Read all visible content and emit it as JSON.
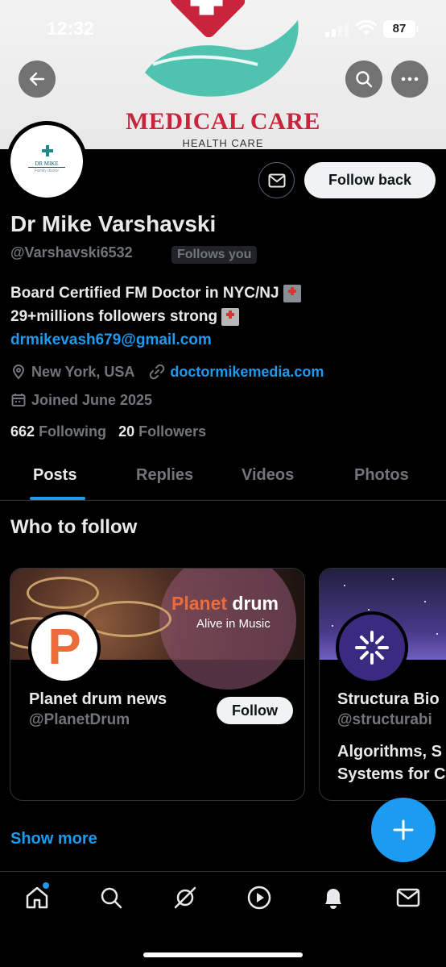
{
  "status_bar": {
    "time": "12:32",
    "battery": "87"
  },
  "banner": {
    "title": "MEDICAL CARE",
    "subtitle": "HEALTH CARE",
    "accent": "#c8243c",
    "hand_color": "#4fc3b0"
  },
  "avatar": {
    "brand": "DR MIKE",
    "brand_sub": "Family doctor"
  },
  "actions": {
    "follow_back_label": "Follow back"
  },
  "profile": {
    "name": "Dr Mike Varshavski",
    "handle": "@Varshavski6532",
    "follows_you": "Follows you",
    "bio_line1": "Board Certified FM Doctor in NYC/NJ",
    "bio_line2": "29+millions followers strong",
    "bio_email": "drmikevash679@gmail.com",
    "location": "New York, USA",
    "website": "doctormikemedia.com",
    "joined": "Joined June 2025",
    "following_count": "662",
    "following_label": "Following",
    "followers_count": "20",
    "followers_label": "Followers"
  },
  "tabs": [
    {
      "label": "Posts",
      "active": true
    },
    {
      "label": "Replies"
    },
    {
      "label": "Videos"
    },
    {
      "label": "Photos"
    }
  ],
  "who_to_follow": {
    "title": "Who to follow",
    "cards": [
      {
        "banner_word1": "Planet",
        "banner_word2": "drum",
        "banner_tagline": "Alive in Music",
        "avatar_letter": "P",
        "name": "Planet drum news",
        "handle": "@PlanetDrum",
        "follow_label": "Follow"
      },
      {
        "name": "Structura Bio",
        "handle": "@structurabi",
        "bio_line1": "Algorithms, S",
        "bio_line2": "Systems for C"
      }
    ],
    "show_more": "Show more"
  },
  "colors": {
    "accent": "#1d9bf0",
    "text": "#e7e9ea",
    "muted": "#71767b",
    "background": "#000000"
  },
  "nav": [
    "home-icon",
    "search-icon",
    "grok-icon",
    "video-icon",
    "notifications-icon",
    "messages-icon"
  ]
}
